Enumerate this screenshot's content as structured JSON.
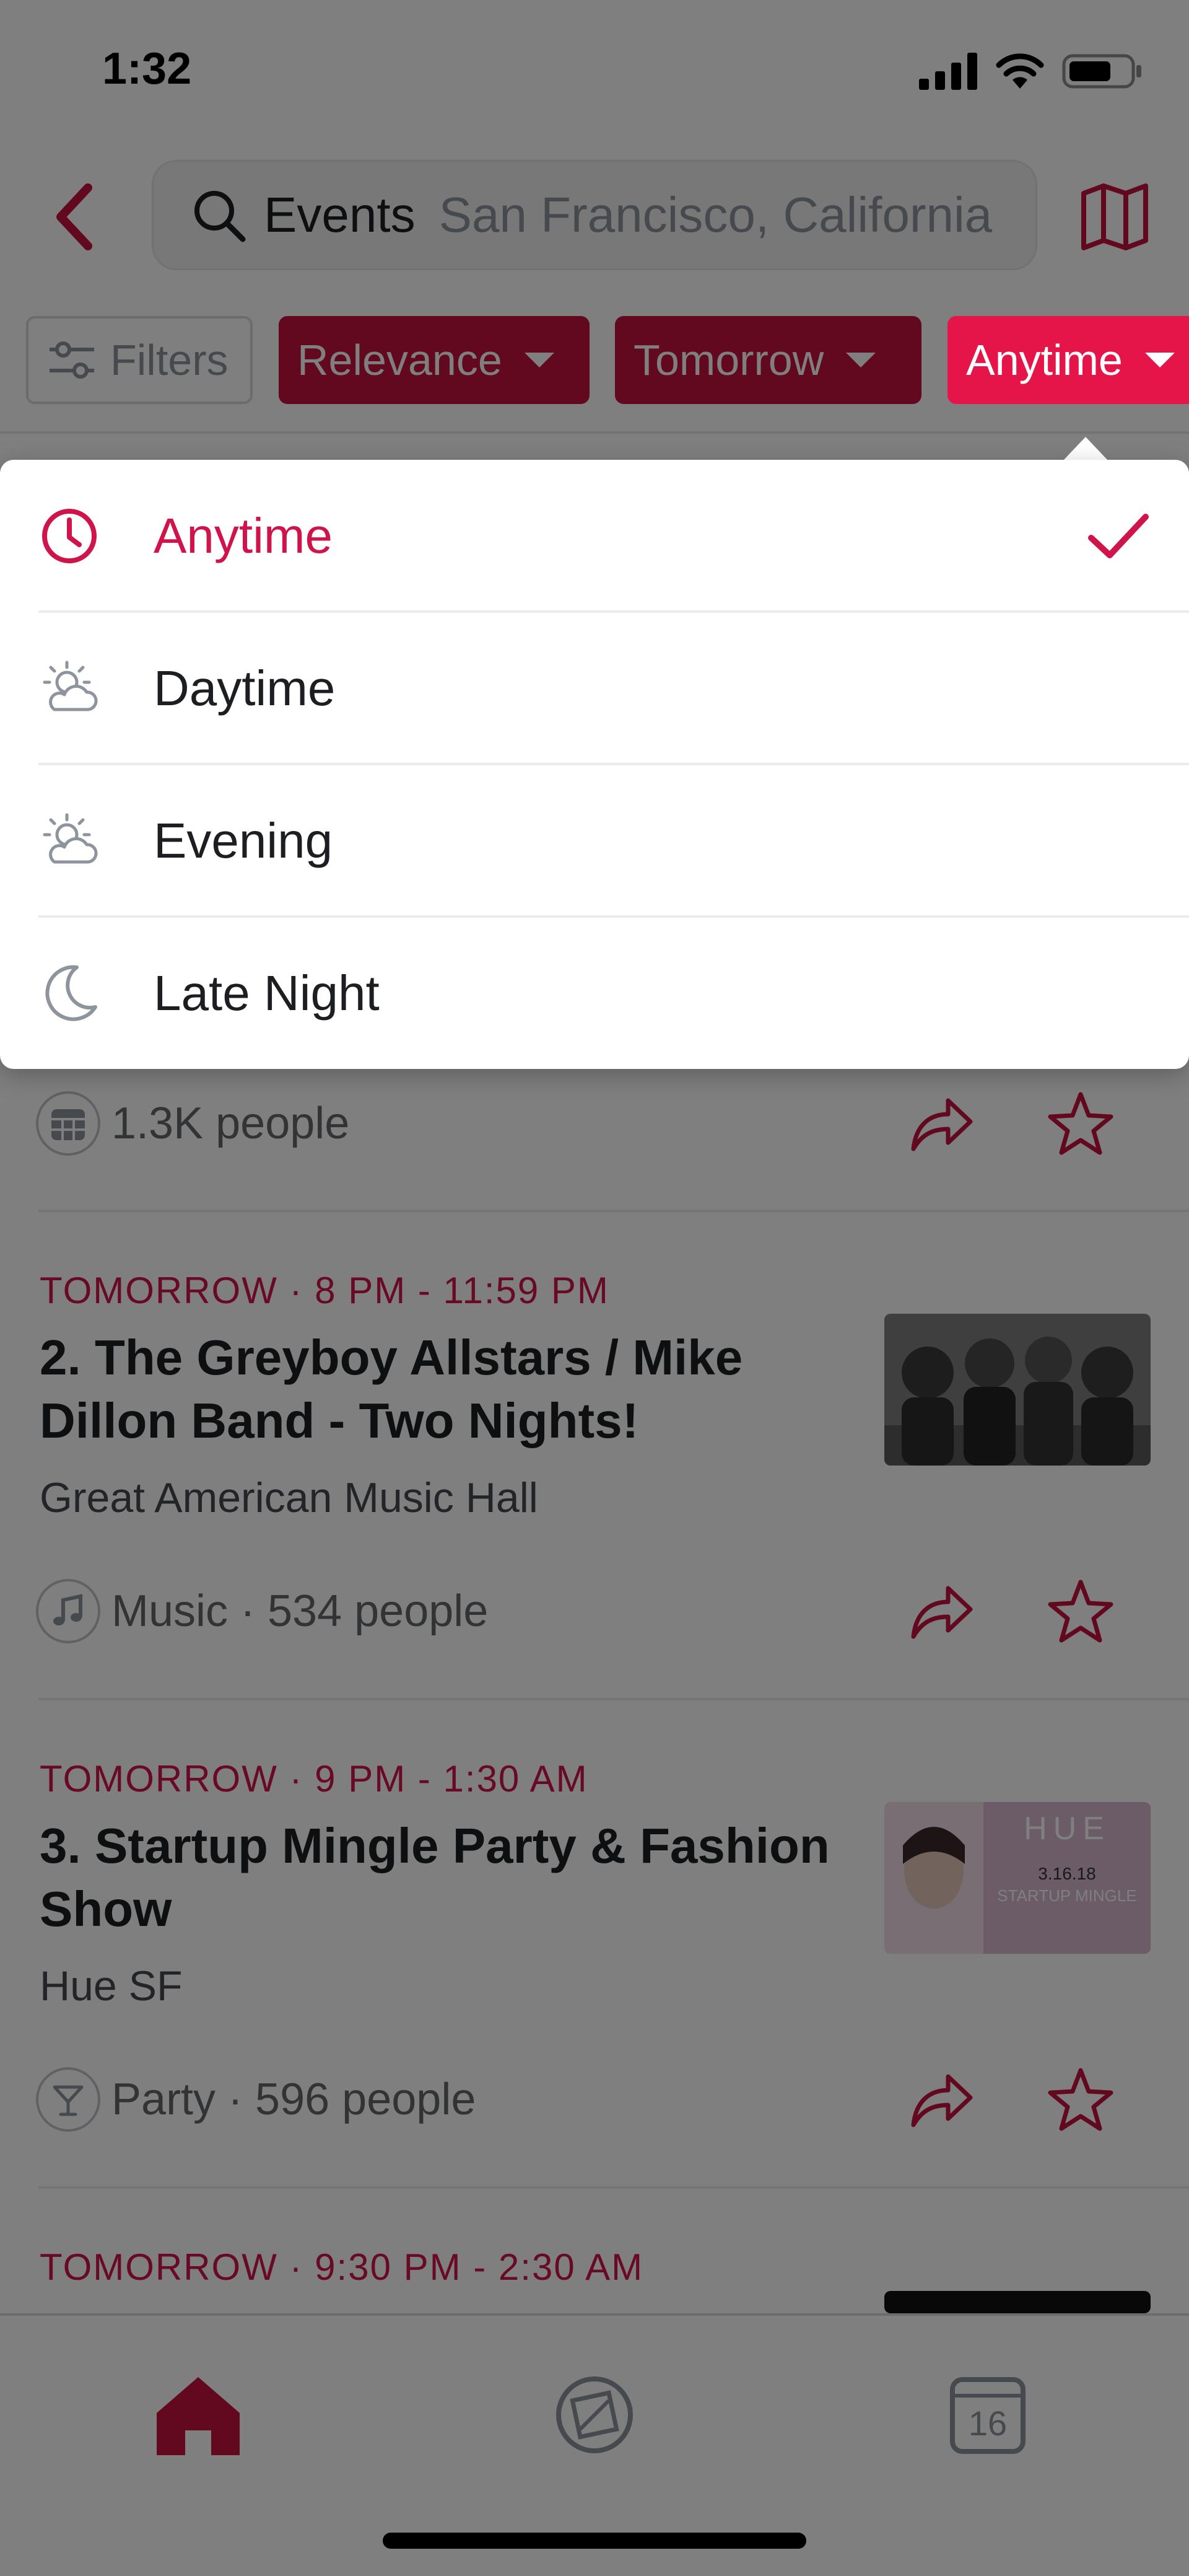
{
  "status_bar": {
    "time": "1:32"
  },
  "search": {
    "query": "Events",
    "location": "San Francisco, California"
  },
  "chips": {
    "filters_label": "Filters",
    "relevance_label": "Relevance",
    "tomorrow_label": "Tomorrow",
    "anytime_label": "Anytime"
  },
  "time_dropdown": {
    "options": [
      {
        "label": "Anytime",
        "icon": "clock-icon",
        "selected": true
      },
      {
        "label": "Daytime",
        "icon": "sun-cloud-icon",
        "selected": false
      },
      {
        "label": "Evening",
        "icon": "sun-cloud-icon",
        "selected": false
      },
      {
        "label": "Late Night",
        "icon": "moon-icon",
        "selected": false
      }
    ]
  },
  "events": [
    {
      "meta": "1.3K people",
      "icon": "calendar-icon"
    },
    {
      "when": "TOMORROW · 8 PM - 11:59 PM",
      "title": "2. The Greyboy Allstars / Mike Dillon Band - Two Nights!",
      "venue": "Great American Music Hall",
      "meta": "Music · 534 people",
      "icon": "music-note-icon"
    },
    {
      "when": "TOMORROW · 9 PM - 1:30 AM",
      "title": "3. Startup Mingle Party & Fashion Show",
      "venue": "Hue SF",
      "meta": "Party · 596 people",
      "icon": "cocktail-icon",
      "thumb_text": {
        "brand": "HUE",
        "date": "3.16.18",
        "tag": "STARTUP MINGLE"
      }
    },
    {
      "when": "TOMORROW · 9:30 PM - 2:30 AM"
    }
  ],
  "tabbar": {
    "calendar_day": "16"
  },
  "colors": {
    "brand": "#c4123e",
    "accent": "#e5154a",
    "text_red": "#d0134a"
  }
}
